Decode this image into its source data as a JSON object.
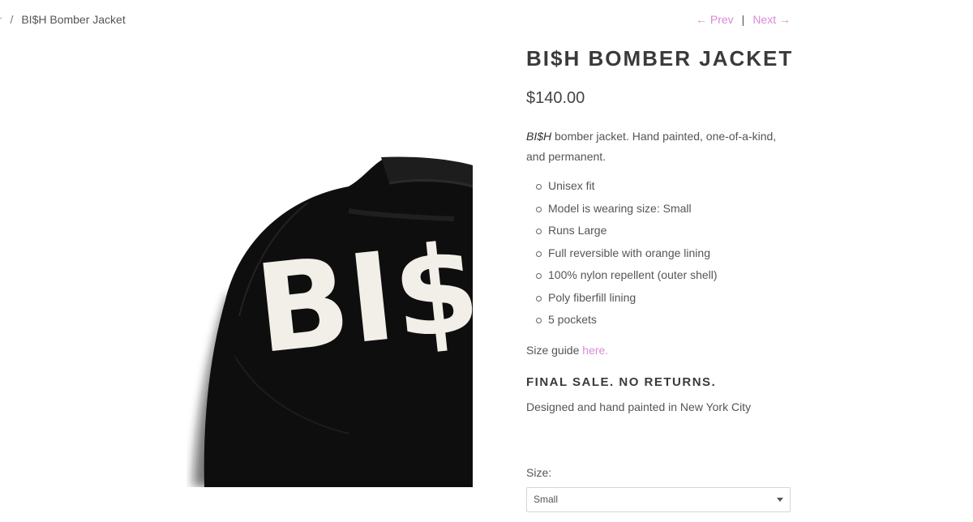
{
  "breadcrumb": {
    "parent_label": "ar",
    "separator": "/",
    "current": "BI$H Bomber Jacket"
  },
  "pager": {
    "prev": "← Prev",
    "divider": "|",
    "next": "Next →"
  },
  "product": {
    "title": "BI$H BOMBER JACKET",
    "price": "$140.00",
    "description_brand": "BI$H",
    "description_rest": " bomber jacket. Hand painted, one-of-a-kind, and permanent.",
    "features": [
      "Unisex fit",
      "Model is wearing size: Small",
      "Runs Large",
      "Full reversible with orange lining",
      "100% nylon repellent (outer shell)",
      "Poly fiberfill lining",
      "5 pockets"
    ],
    "size_guide_text": "Size guide ",
    "size_guide_link": "here.",
    "final_sale": "FINAL SALE. NO RETURNS.",
    "origin": "Designed and hand painted in New York City",
    "image_text": "BI$"
  },
  "size_select": {
    "label": "Size:",
    "value": "Small"
  },
  "colors": {
    "link": "#d88ad8",
    "heading": "#3a3a3a"
  }
}
